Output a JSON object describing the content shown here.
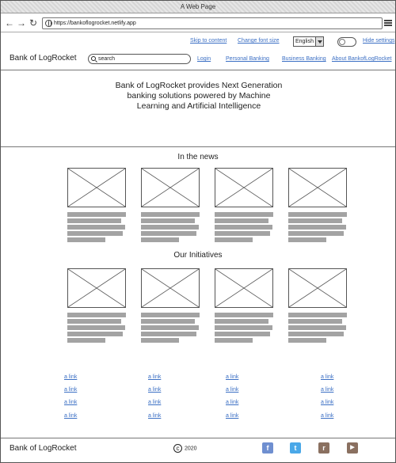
{
  "window": {
    "title": "A Web Page"
  },
  "browser": {
    "url": "https://bankoflogrocket.netlify.app"
  },
  "utility": {
    "skip": "Skip to content",
    "font": "Change font size",
    "language": "English",
    "hide": "Hide settings"
  },
  "header": {
    "brand": "Bank of LogRocket",
    "search_placeholder": "search",
    "nav": [
      "Login",
      "Personal Banking",
      "Business Banking",
      "About BankofLogRocket"
    ]
  },
  "hero": {
    "line1": "Bank of LogRocket provides Next Generation",
    "line2": "banking solutions powered by Machine",
    "line3": "Learning and Artificial Intelligence"
  },
  "news": {
    "title": "In the news"
  },
  "initiatives": {
    "title": "Our Initiatives"
  },
  "links": {
    "label": "a link"
  },
  "footer": {
    "brand": "Bank of LogRocket",
    "year": "2020"
  },
  "colors": {
    "link": "#3b6fc4",
    "facebook": "#6f8fd0",
    "twitter": "#4aa8e8",
    "reddit": "#8a7060",
    "youtube": "#8a7060"
  }
}
